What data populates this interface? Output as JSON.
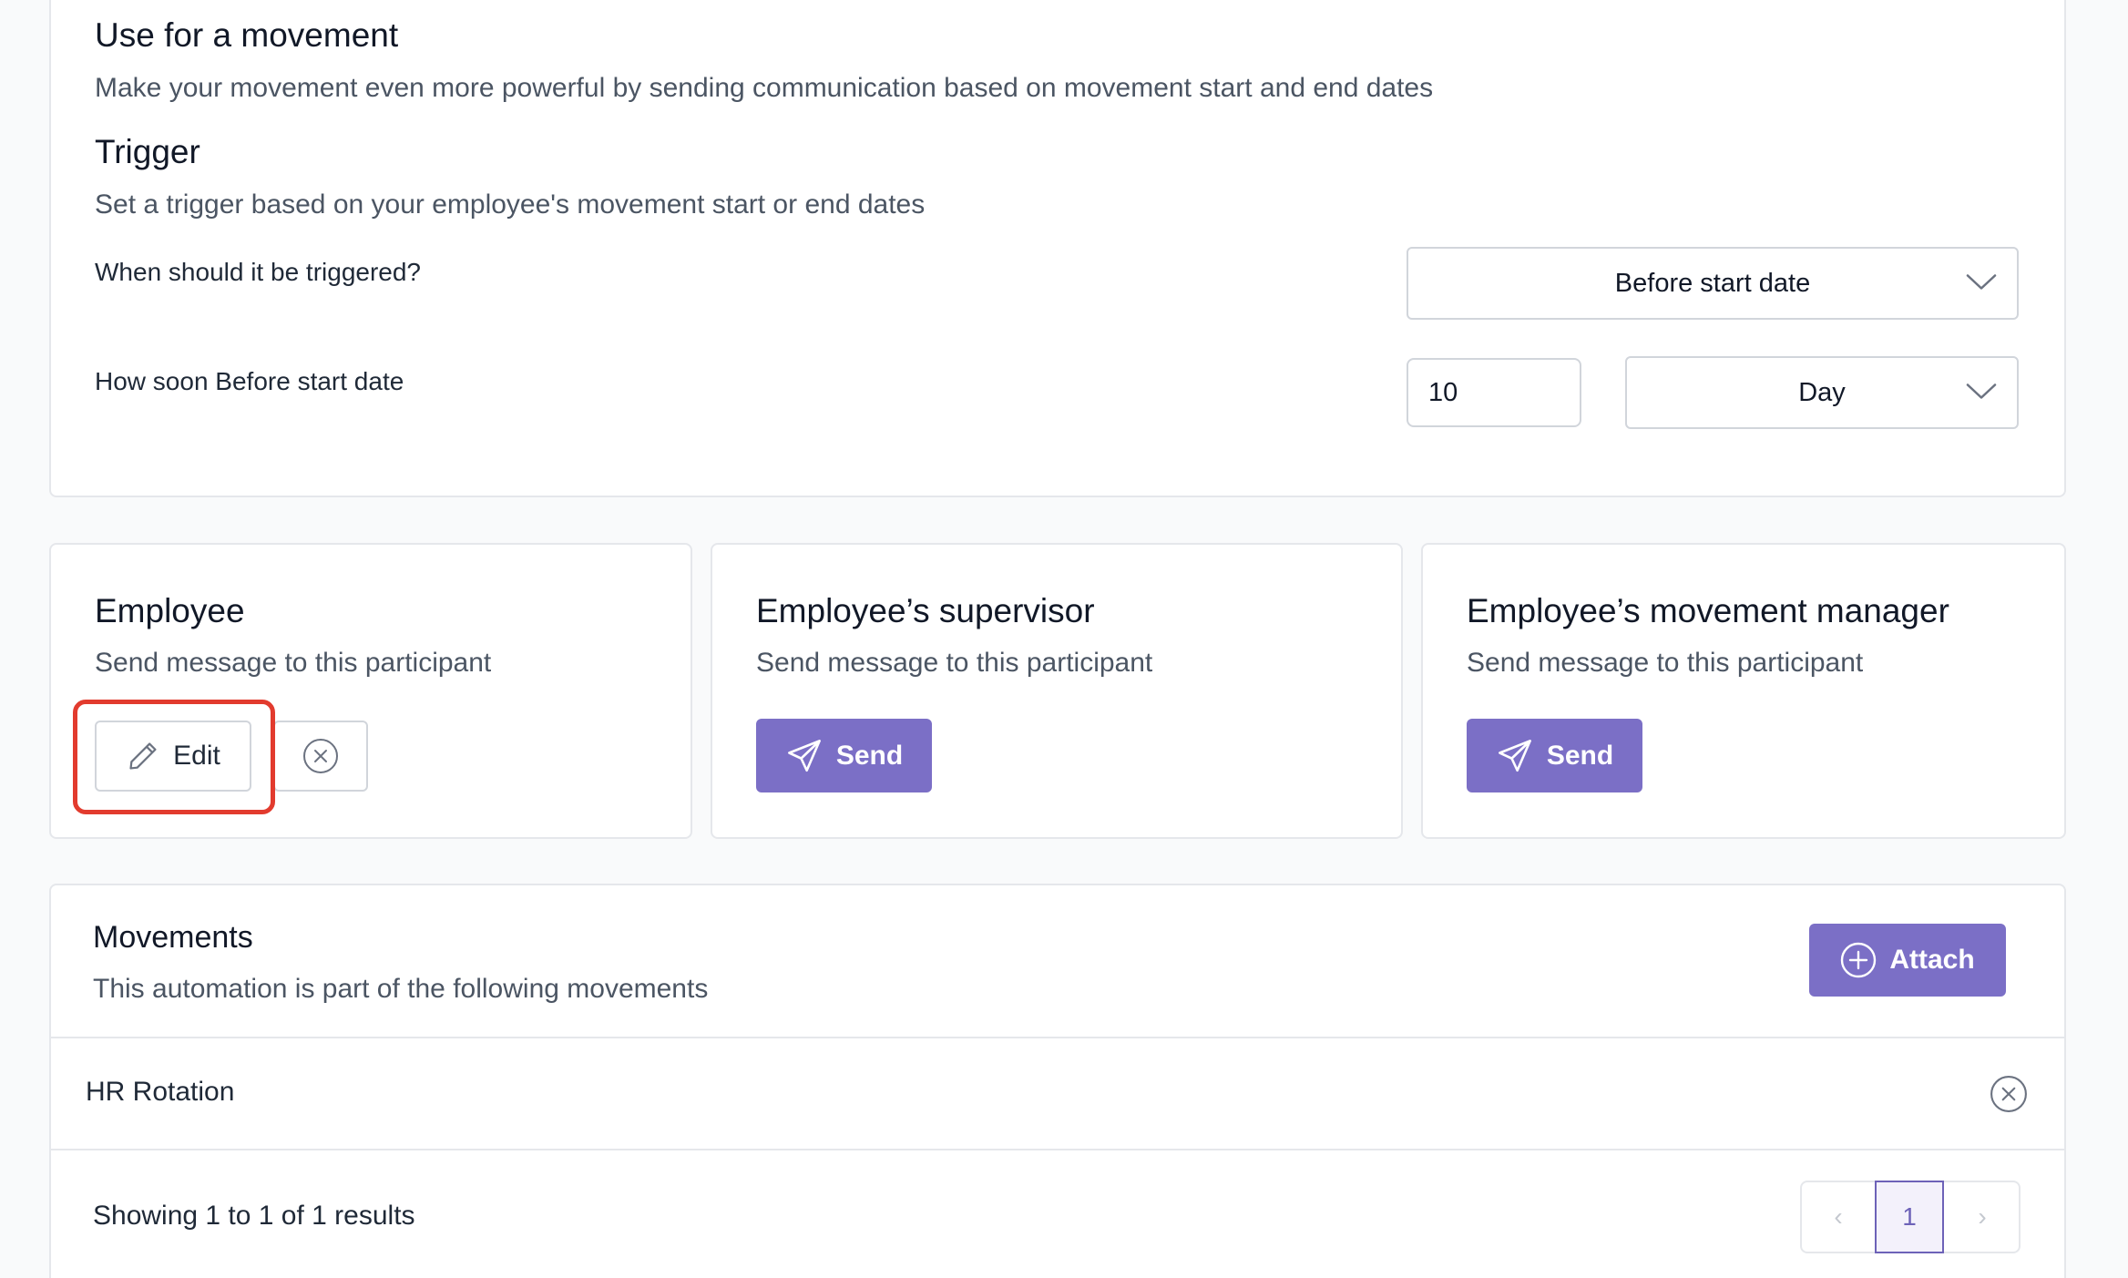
{
  "movement_section": {
    "title": "Use for a movement",
    "subtitle": "Make your movement even more powerful by sending communication based on movement start and end dates",
    "trigger_title": "Trigger",
    "trigger_subtitle": "Set a trigger based on your employee's movement start or end dates",
    "when_label": "When should it be triggered?",
    "when_value": "Before start date",
    "how_soon_label": "How soon Before start date",
    "how_soon_number": "10",
    "how_soon_unit": "Day"
  },
  "participants": [
    {
      "title": "Employee",
      "subtitle": "Send message to this participant",
      "action_label": "Edit"
    },
    {
      "title": "Employee’s supervisor",
      "subtitle": "Send message to this participant",
      "action_label": "Send"
    },
    {
      "title": "Employee’s movement manager",
      "subtitle": "Send message to this participant",
      "action_label": "Send"
    }
  ],
  "movements": {
    "title": "Movements",
    "subtitle": "This automation is part of the following movements",
    "attach_label": "Attach",
    "rows": [
      {
        "name": "HR Rotation"
      }
    ],
    "results_text": "Showing 1 to 1 of 1 results",
    "pagination": {
      "prev": "‹",
      "current_page": "1",
      "next": "›"
    }
  },
  "colors": {
    "accent": "#7b6fc6",
    "highlight": "#e23b2e"
  },
  "icons": [
    "chevron-down-icon",
    "pencil-icon",
    "close-circle-icon",
    "paper-plane-icon",
    "plus-circle-icon"
  ]
}
